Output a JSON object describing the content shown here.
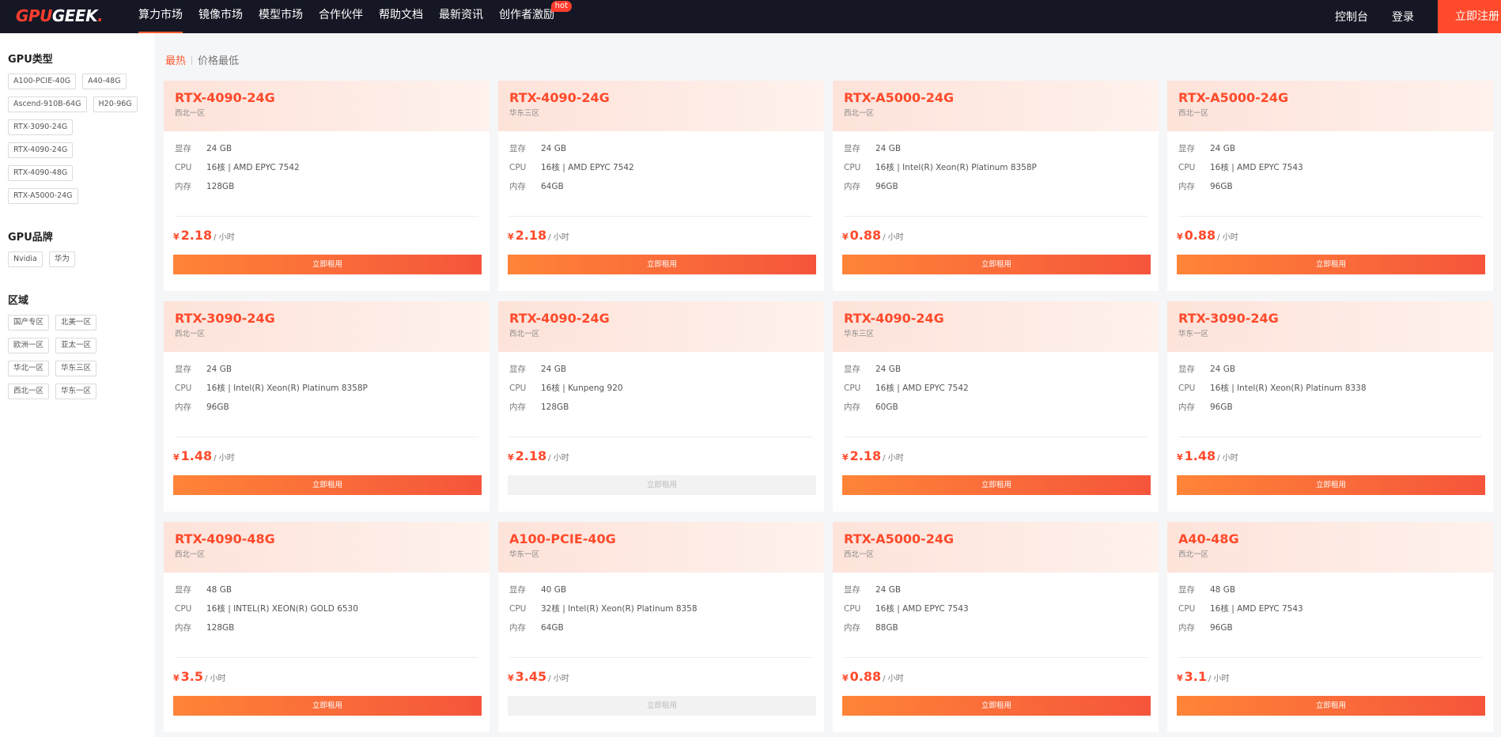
{
  "nav": {
    "logo_a": "GPU",
    "logo_b": "GEEK",
    "logo_dot": ".",
    "links": [
      "算力市场",
      "镜像市场",
      "模型市场",
      "合作伙伴",
      "帮助文档",
      "最新资讯",
      "创作者激励"
    ],
    "hot_badge": "hot",
    "console": "控制台",
    "login": "登录",
    "register": "立即注册"
  },
  "sidebar": {
    "gpu_type_title": "GPU类型",
    "gpu_types": [
      "A100-PCIE-40G",
      "A40-48G",
      "Ascend-910B-64G",
      "H20-96G",
      "RTX-3090-24G",
      "RTX-4090-24G",
      "RTX-4090-48G",
      "RTX-A5000-24G"
    ],
    "brand_title": "GPU品牌",
    "brands": [
      "Nvidia",
      "华为"
    ],
    "region_title": "区域",
    "regions": [
      "国产专区",
      "北美一区",
      "欧洲一区",
      "亚太一区",
      "华北一区",
      "华东三区",
      "西北一区",
      "华东一区"
    ]
  },
  "sort": {
    "hot": "最热",
    "price_low": "价格最低"
  },
  "labels": {
    "vram": "显存",
    "cpu": "CPU",
    "mem": "内存",
    "currency": "¥",
    "unit": "/ 小时",
    "rent": "立即租用"
  },
  "cards": [
    {
      "title": "RTX-4090-24G",
      "region": "西北一区",
      "vram": "24 GB",
      "cpu": "16核 | AMD EPYC 7542",
      "mem": "128GB",
      "price": "2.18",
      "available": true
    },
    {
      "title": "RTX-4090-24G",
      "region": "华东三区",
      "vram": "24 GB",
      "cpu": "16核 | AMD EPYC 7542",
      "mem": "64GB",
      "price": "2.18",
      "available": true
    },
    {
      "title": "RTX-A5000-24G",
      "region": "西北一区",
      "vram": "24 GB",
      "cpu": "16核 | Intel(R) Xeon(R) Platinum 8358P",
      "mem": "96GB",
      "price": "0.88",
      "available": true
    },
    {
      "title": "RTX-A5000-24G",
      "region": "西北一区",
      "vram": "24 GB",
      "cpu": "16核 | AMD EPYC 7543",
      "mem": "96GB",
      "price": "0.88",
      "available": true
    },
    {
      "title": "RTX-3090-24G",
      "region": "西北一区",
      "vram": "24 GB",
      "cpu": "16核 | Intel(R) Xeon(R) Platinum 8358P",
      "mem": "96GB",
      "price": "1.48",
      "available": true
    },
    {
      "title": "RTX-4090-24G",
      "region": "西北一区",
      "vram": "24 GB",
      "cpu": "16核 | Kunpeng 920",
      "mem": "128GB",
      "price": "2.18",
      "available": false
    },
    {
      "title": "RTX-4090-24G",
      "region": "华东三区",
      "vram": "24 GB",
      "cpu": "16核 | AMD EPYC 7542",
      "mem": "60GB",
      "price": "2.18",
      "available": true
    },
    {
      "title": "RTX-3090-24G",
      "region": "华东一区",
      "vram": "24 GB",
      "cpu": "16核 | Intel(R) Xeon(R) Platinum 8338",
      "mem": "96GB",
      "price": "1.48",
      "available": true
    },
    {
      "title": "RTX-4090-48G",
      "region": "西北一区",
      "vram": "48 GB",
      "cpu": "16核 | INTEL(R) XEON(R) GOLD 6530",
      "mem": "128GB",
      "price": "3.5",
      "available": true
    },
    {
      "title": "A100-PCIE-40G",
      "region": "华东一区",
      "vram": "40 GB",
      "cpu": "32核 | Intel(R) Xeon(R) Platinum 8358",
      "mem": "64GB",
      "price": "3.45",
      "available": false
    },
    {
      "title": "RTX-A5000-24G",
      "region": "西北一区",
      "vram": "24 GB",
      "cpu": "16核 | AMD EPYC 7543",
      "mem": "88GB",
      "price": "0.88",
      "available": true
    },
    {
      "title": "A40-48G",
      "region": "西北一区",
      "vram": "48 GB",
      "cpu": "16核 | AMD EPYC 7543",
      "mem": "96GB",
      "price": "3.1",
      "available": true
    }
  ]
}
